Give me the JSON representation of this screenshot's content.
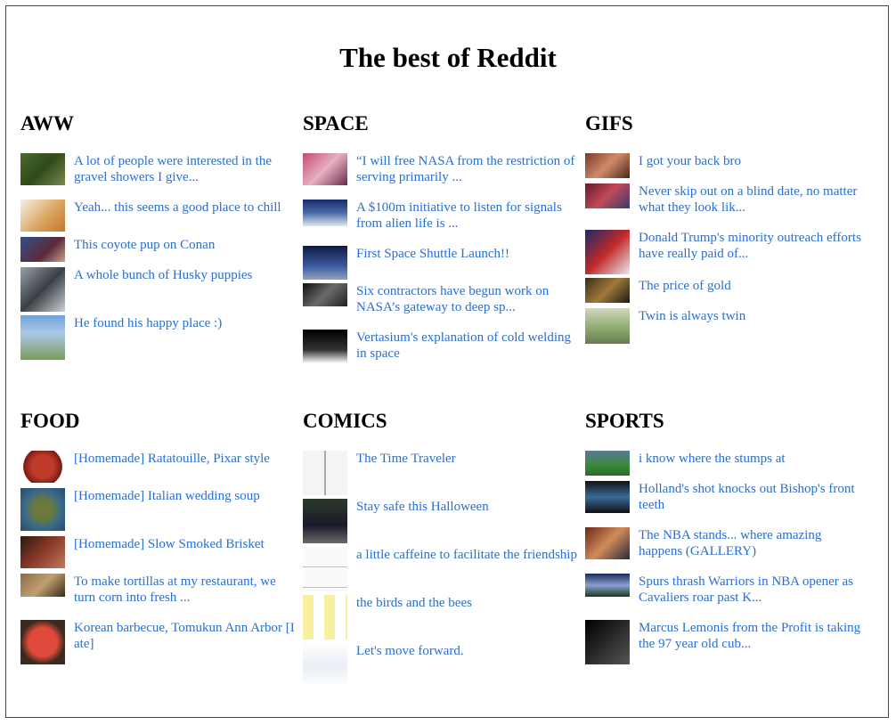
{
  "page": {
    "title": "The best of Reddit"
  },
  "sections": [
    {
      "title": "AWW",
      "items": [
        {
          "text": "A lot of people were interested in the gravel showers I give...",
          "thumb": "cat-photo"
        },
        {
          "text": "Yeah... this seems a good place to chill",
          "thumb": "dog-photo"
        },
        {
          "text": "This coyote pup on Conan",
          "thumb": "talk-show-photo"
        },
        {
          "text": "A whole bunch of Husky puppies",
          "thumb": "husky-photo"
        },
        {
          "text": "He found his happy place :)",
          "thumb": "dog-in-field-photo"
        }
      ]
    },
    {
      "title": "SPACE",
      "items": [
        {
          "text": "“I will free NASA from the restriction of serving primarily ...",
          "thumb": "crowd-photo"
        },
        {
          "text": "A $100m initiative to listen for signals from alien life is ...",
          "thumb": "radio-telescope-photo"
        },
        {
          "text": "First Space Shuttle Launch!!",
          "thumb": "shuttle-launch-photo"
        },
        {
          "text": "Six contractors have begun work on NASA’s gateway to deep sp...",
          "thumb": "astronaut-photo"
        },
        {
          "text": "Vertasium's explanation of cold welding in space",
          "thumb": "space-welding-thumbnail"
        }
      ]
    },
    {
      "title": "GIFS",
      "items": [
        {
          "text": "I got your back bro",
          "thumb": "gif-frame"
        },
        {
          "text": "Never skip out on a blind date, no matter what they look lik...",
          "thumb": "gif-frame"
        },
        {
          "text": "Donald Trump's minority outreach efforts have really paid of...",
          "thumb": "gif-frame"
        },
        {
          "text": "The price of gold",
          "thumb": "gif-frame"
        },
        {
          "text": "Twin is always twin",
          "thumb": "gif-frame"
        }
      ]
    },
    {
      "title": "FOOD",
      "items": [
        {
          "text": "[Homemade] Ratatouille, Pixar style",
          "thumb": "ratatouille-photo"
        },
        {
          "text": "[Homemade] Italian wedding soup",
          "thumb": "soup-photo"
        },
        {
          "text": "[Homemade] Slow Smoked Brisket",
          "thumb": "brisket-photo"
        },
        {
          "text": "To make tortillas at my restaurant, we turn corn into fresh ...",
          "thumb": "corn-photo"
        },
        {
          "text": "Korean barbecue, Tomukun Ann Arbor [I ate]",
          "thumb": "barbecue-photo"
        }
      ]
    },
    {
      "title": "COMICS",
      "items": [
        {
          "text": "The Time Traveler",
          "thumb": "comic-panel"
        },
        {
          "text": "Stay safe this Halloween",
          "thumb": "comic-panel"
        },
        {
          "text": "a little caffeine to facilitate the friendship",
          "thumb": "comic-panel"
        },
        {
          "text": "the birds and the bees",
          "thumb": "comic-panel"
        },
        {
          "text": "Let's move forward.",
          "thumb": "comic-panel"
        }
      ]
    },
    {
      "title": "SPORTS",
      "items": [
        {
          "text": "i know where the stumps at",
          "thumb": "cricket-photo"
        },
        {
          "text": "Holland's shot knocks out Bishop's front teeth",
          "thumb": "boxing-photo"
        },
        {
          "text": "The NBA stands... where amazing happens (GALLERY)",
          "thumb": "nba-photo"
        },
        {
          "text": "Spurs thrash Warriors in NBA opener as Cavaliers roar past K...",
          "thumb": "basketball-photo"
        },
        {
          "text": "Marcus Lemonis from the Profit is taking the 97 year old cub...",
          "thumb": "portrait-photo"
        }
      ]
    }
  ]
}
